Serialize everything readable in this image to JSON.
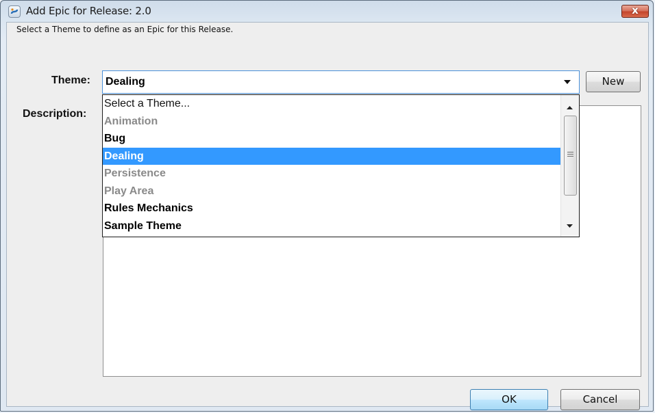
{
  "window": {
    "title": "Add Epic for Release: 2.0",
    "close_label": "x"
  },
  "dialog": {
    "instruction": "Select a Theme to define as an Epic for this Release.",
    "theme_label": "Theme:",
    "description_label": "Description:",
    "theme_value": "Dealing",
    "new_button": "New",
    "ok_button": "OK",
    "cancel_button": "Cancel"
  },
  "dropdown": {
    "items": [
      {
        "label": "Select a Theme...",
        "state": "placeholder"
      },
      {
        "label": "Animation",
        "state": "inactive"
      },
      {
        "label": "Bug",
        "state": "active"
      },
      {
        "label": "Dealing",
        "state": "selected"
      },
      {
        "label": "Persistence",
        "state": "inactive"
      },
      {
        "label": "Play Area",
        "state": "inactive"
      },
      {
        "label": "Rules Mechanics",
        "state": "active"
      },
      {
        "label": "Sample Theme",
        "state": "active"
      }
    ]
  },
  "colors": {
    "selection": "#3399ff",
    "inactive_text": "#8a8a8a",
    "focus_border": "#4a90d9"
  },
  "icons": [
    "app-icon",
    "close-icon",
    "chevron-down-icon",
    "scroll-up-icon",
    "scroll-down-icon"
  ]
}
